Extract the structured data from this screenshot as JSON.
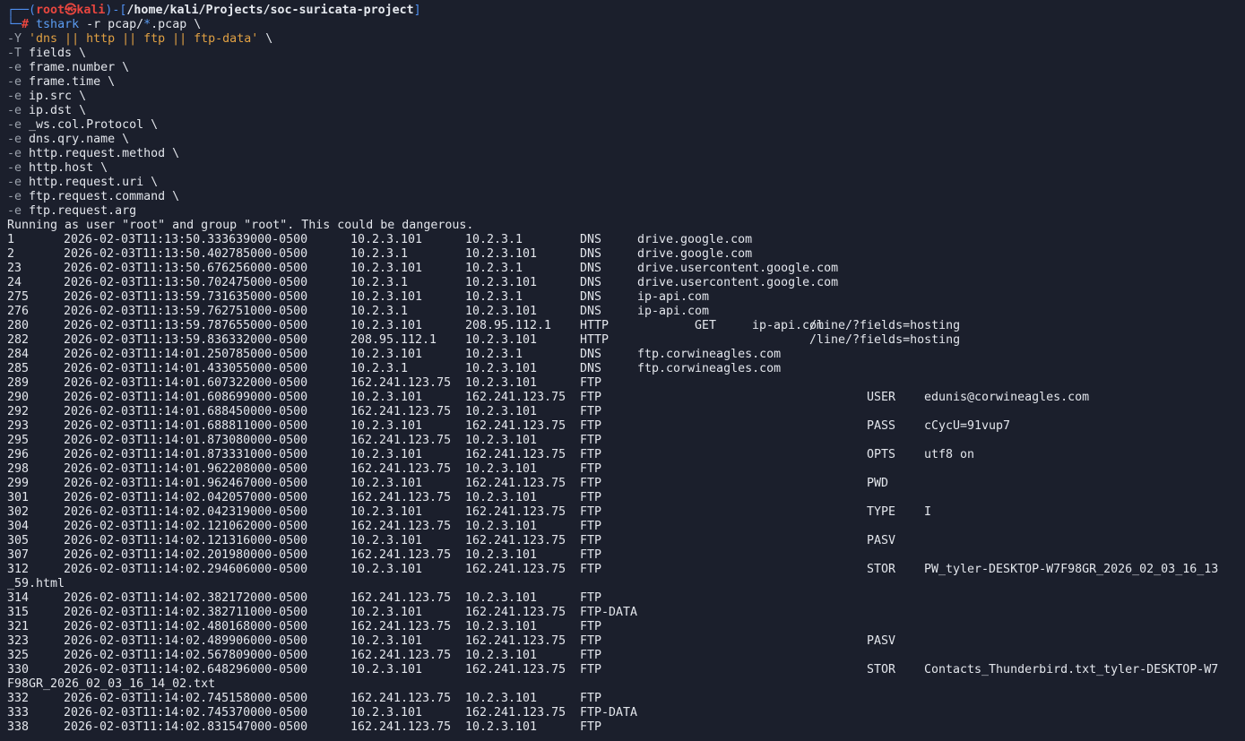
{
  "prompt": {
    "frame_top": "┌──(",
    "user": "root",
    "at": "㉿",
    "host": "kali",
    "sep": ")-[",
    "path": "/home/kali/Projects/soc-suricata-project",
    "close": "]",
    "frame_bottom": "└─",
    "hash": "#"
  },
  "command": {
    "tool": "tshark",
    "args_before": " -r pcap/",
    "glob": "*",
    "args_after": ".pcap \\",
    "filter_flag": "-Y",
    "filter": "'dns || http || ftp || ftp-data'",
    "filter_tail": " \\",
    "fields_flag": "-T",
    "fields": " fields \\",
    "e_lines": [
      "frame.number \\",
      "frame.time \\",
      "ip.src \\",
      "ip.dst \\",
      "_ws.col.Protocol \\",
      "dns.qry.name \\",
      "http.request.method \\",
      "http.host \\",
      "http.request.uri \\",
      "ftp.request.command \\",
      "ftp.request.arg"
    ],
    "e_flag": "-e"
  },
  "warning": "Running as user \"root\" and group \"root\". This could be dangerous.",
  "rows": [
    {
      "n": "1",
      "t": "2026-02-03T11:13:50.333639000-0500",
      "s": "10.2.3.101",
      "d": "10.2.3.1",
      "p": "DNS",
      "q": "drive.google.com",
      "m": "",
      "h": "",
      "u": "",
      "fc": "",
      "fa": ""
    },
    {
      "n": "2",
      "t": "2026-02-03T11:13:50.402785000-0500",
      "s": "10.2.3.1",
      "d": "10.2.3.101",
      "p": "DNS",
      "q": "drive.google.com",
      "m": "",
      "h": "",
      "u": "",
      "fc": "",
      "fa": ""
    },
    {
      "n": "23",
      "t": "2026-02-03T11:13:50.676256000-0500",
      "s": "10.2.3.101",
      "d": "10.2.3.1",
      "p": "DNS",
      "q": "drive.usercontent.google.com",
      "m": "",
      "h": "",
      "u": "",
      "fc": "",
      "fa": ""
    },
    {
      "n": "24",
      "t": "2026-02-03T11:13:50.702475000-0500",
      "s": "10.2.3.1",
      "d": "10.2.3.101",
      "p": "DNS",
      "q": "drive.usercontent.google.com",
      "m": "",
      "h": "",
      "u": "",
      "fc": "",
      "fa": ""
    },
    {
      "n": "275",
      "t": "2026-02-03T11:13:59.731635000-0500",
      "s": "10.2.3.101",
      "d": "10.2.3.1",
      "p": "DNS",
      "q": "ip-api.com",
      "m": "",
      "h": "",
      "u": "",
      "fc": "",
      "fa": ""
    },
    {
      "n": "276",
      "t": "2026-02-03T11:13:59.762751000-0500",
      "s": "10.2.3.1",
      "d": "10.2.3.101",
      "p": "DNS",
      "q": "ip-api.com",
      "m": "",
      "h": "",
      "u": "",
      "fc": "",
      "fa": ""
    },
    {
      "n": "280",
      "t": "2026-02-03T11:13:59.787655000-0500",
      "s": "10.2.3.101",
      "d": "208.95.112.1",
      "p": "HTTP",
      "q": "",
      "m": "GET",
      "h": "ip-api.com",
      "u": "/line/?fields=hosting",
      "fc": "",
      "fa": ""
    },
    {
      "n": "282",
      "t": "2026-02-03T11:13:59.836332000-0500",
      "s": "208.95.112.1",
      "d": "10.2.3.101",
      "p": "HTTP",
      "q": "",
      "m": "",
      "h": "",
      "u": "/line/?fields=hosting",
      "fc": "",
      "fa": ""
    },
    {
      "n": "284",
      "t": "2026-02-03T11:14:01.250785000-0500",
      "s": "10.2.3.101",
      "d": "10.2.3.1",
      "p": "DNS",
      "q": "ftp.corwineagles.com",
      "m": "",
      "h": "",
      "u": "",
      "fc": "",
      "fa": ""
    },
    {
      "n": "285",
      "t": "2026-02-03T11:14:01.433055000-0500",
      "s": "10.2.3.1",
      "d": "10.2.3.101",
      "p": "DNS",
      "q": "ftp.corwineagles.com",
      "m": "",
      "h": "",
      "u": "",
      "fc": "",
      "fa": ""
    },
    {
      "n": "289",
      "t": "2026-02-03T11:14:01.607322000-0500",
      "s": "162.241.123.75",
      "d": "10.2.3.101",
      "p": "FTP",
      "q": "",
      "m": "",
      "h": "",
      "u": "",
      "fc": "",
      "fa": ""
    },
    {
      "n": "290",
      "t": "2026-02-03T11:14:01.608699000-0500",
      "s": "10.2.3.101",
      "d": "162.241.123.75",
      "p": "FTP",
      "q": "",
      "m": "",
      "h": "",
      "u": "",
      "fc": "USER",
      "fa": "edunis@corwineagles.com"
    },
    {
      "n": "292",
      "t": "2026-02-03T11:14:01.688450000-0500",
      "s": "162.241.123.75",
      "d": "10.2.3.101",
      "p": "FTP",
      "q": "",
      "m": "",
      "h": "",
      "u": "",
      "fc": "",
      "fa": ""
    },
    {
      "n": "293",
      "t": "2026-02-03T11:14:01.688811000-0500",
      "s": "10.2.3.101",
      "d": "162.241.123.75",
      "p": "FTP",
      "q": "",
      "m": "",
      "h": "",
      "u": "",
      "fc": "PASS",
      "fa": "cCycU=91vup7"
    },
    {
      "n": "295",
      "t": "2026-02-03T11:14:01.873080000-0500",
      "s": "162.241.123.75",
      "d": "10.2.3.101",
      "p": "FTP",
      "q": "",
      "m": "",
      "h": "",
      "u": "",
      "fc": "",
      "fa": ""
    },
    {
      "n": "296",
      "t": "2026-02-03T11:14:01.873331000-0500",
      "s": "10.2.3.101",
      "d": "162.241.123.75",
      "p": "FTP",
      "q": "",
      "m": "",
      "h": "",
      "u": "",
      "fc": "OPTS",
      "fa": "utf8 on"
    },
    {
      "n": "298",
      "t": "2026-02-03T11:14:01.962208000-0500",
      "s": "162.241.123.75",
      "d": "10.2.3.101",
      "p": "FTP",
      "q": "",
      "m": "",
      "h": "",
      "u": "",
      "fc": "",
      "fa": ""
    },
    {
      "n": "299",
      "t": "2026-02-03T11:14:01.962467000-0500",
      "s": "10.2.3.101",
      "d": "162.241.123.75",
      "p": "FTP",
      "q": "",
      "m": "",
      "h": "",
      "u": "",
      "fc": "PWD",
      "fa": ""
    },
    {
      "n": "301",
      "t": "2026-02-03T11:14:02.042057000-0500",
      "s": "162.241.123.75",
      "d": "10.2.3.101",
      "p": "FTP",
      "q": "",
      "m": "",
      "h": "",
      "u": "",
      "fc": "",
      "fa": ""
    },
    {
      "n": "302",
      "t": "2026-02-03T11:14:02.042319000-0500",
      "s": "10.2.3.101",
      "d": "162.241.123.75",
      "p": "FTP",
      "q": "",
      "m": "",
      "h": "",
      "u": "",
      "fc": "TYPE",
      "fa": "I"
    },
    {
      "n": "304",
      "t": "2026-02-03T11:14:02.121062000-0500",
      "s": "162.241.123.75",
      "d": "10.2.3.101",
      "p": "FTP",
      "q": "",
      "m": "",
      "h": "",
      "u": "",
      "fc": "",
      "fa": ""
    },
    {
      "n": "305",
      "t": "2026-02-03T11:14:02.121316000-0500",
      "s": "10.2.3.101",
      "d": "162.241.123.75",
      "p": "FTP",
      "q": "",
      "m": "",
      "h": "",
      "u": "",
      "fc": "PASV",
      "fa": ""
    },
    {
      "n": "307",
      "t": "2026-02-03T11:14:02.201980000-0500",
      "s": "162.241.123.75",
      "d": "10.2.3.101",
      "p": "FTP",
      "q": "",
      "m": "",
      "h": "",
      "u": "",
      "fc": "",
      "fa": ""
    },
    {
      "n": "312",
      "t": "2026-02-03T11:14:02.294606000-0500",
      "s": "10.2.3.101",
      "d": "162.241.123.75",
      "p": "FTP",
      "q": "",
      "m": "",
      "h": "",
      "u": "",
      "fc": "STOR",
      "fa": "PW_tyler-DESKTOP-W7F98GR_2026_02_03_16_13",
      "wrap": "_59.html"
    },
    {
      "n": "314",
      "t": "2026-02-03T11:14:02.382172000-0500",
      "s": "162.241.123.75",
      "d": "10.2.3.101",
      "p": "FTP",
      "q": "",
      "m": "",
      "h": "",
      "u": "",
      "fc": "",
      "fa": ""
    },
    {
      "n": "315",
      "t": "2026-02-03T11:14:02.382711000-0500",
      "s": "10.2.3.101",
      "d": "162.241.123.75",
      "p": "FTP-DATA",
      "q": "",
      "m": "",
      "h": "",
      "u": "",
      "fc": "",
      "fa": ""
    },
    {
      "n": "321",
      "t": "2026-02-03T11:14:02.480168000-0500",
      "s": "162.241.123.75",
      "d": "10.2.3.101",
      "p": "FTP",
      "q": "",
      "m": "",
      "h": "",
      "u": "",
      "fc": "",
      "fa": ""
    },
    {
      "n": "323",
      "t": "2026-02-03T11:14:02.489906000-0500",
      "s": "10.2.3.101",
      "d": "162.241.123.75",
      "p": "FTP",
      "q": "",
      "m": "",
      "h": "",
      "u": "",
      "fc": "PASV",
      "fa": ""
    },
    {
      "n": "325",
      "t": "2026-02-03T11:14:02.567809000-0500",
      "s": "162.241.123.75",
      "d": "10.2.3.101",
      "p": "FTP",
      "q": "",
      "m": "",
      "h": "",
      "u": "",
      "fc": "",
      "fa": ""
    },
    {
      "n": "330",
      "t": "2026-02-03T11:14:02.648296000-0500",
      "s": "10.2.3.101",
      "d": "162.241.123.75",
      "p": "FTP",
      "q": "",
      "m": "",
      "h": "",
      "u": "",
      "fc": "STOR",
      "fa": "Contacts_Thunderbird.txt_tyler-DESKTOP-W7",
      "wrap": "F98GR_2026_02_03_16_14_02.txt"
    },
    {
      "n": "332",
      "t": "2026-02-03T11:14:02.745158000-0500",
      "s": "162.241.123.75",
      "d": "10.2.3.101",
      "p": "FTP",
      "q": "",
      "m": "",
      "h": "",
      "u": "",
      "fc": "",
      "fa": ""
    },
    {
      "n": "333",
      "t": "2026-02-03T11:14:02.745370000-0500",
      "s": "10.2.3.101",
      "d": "162.241.123.75",
      "p": "FTP-DATA",
      "q": "",
      "m": "",
      "h": "",
      "u": "",
      "fc": "",
      "fa": ""
    },
    {
      "n": "338",
      "t": "2026-02-03T11:14:02.831547000-0500",
      "s": "162.241.123.75",
      "d": "10.2.3.101",
      "p": "FTP",
      "q": "",
      "m": "",
      "h": "",
      "u": "",
      "fc": "",
      "fa": ""
    }
  ],
  "colors": {
    "background": "#1b1f2c",
    "text": "#e3e6ec",
    "prompt_frame": "#4f8ff0",
    "prompt_user": "#e8463f",
    "command_keyword": "#5b9cf2",
    "filter_string": "#e0a043"
  }
}
